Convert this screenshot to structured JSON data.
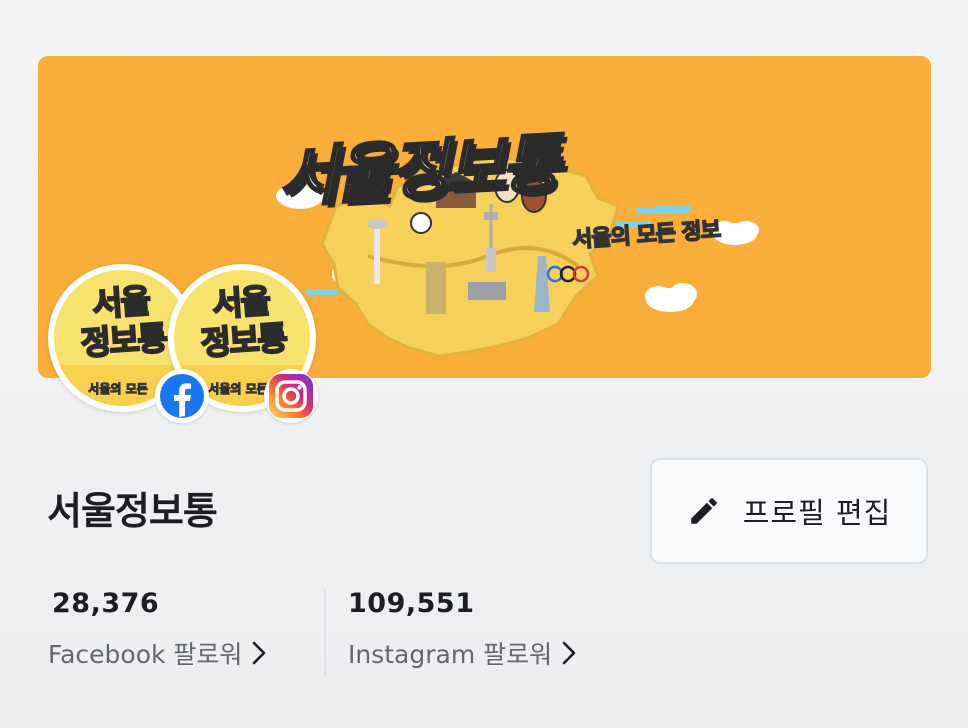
{
  "cover": {
    "title": "서울정보통",
    "subtitle": "서울의 모든 정보",
    "background_color": "#f9ae3a"
  },
  "avatars": [
    {
      "text": "서울\n정보통",
      "sub": "서울의 모든",
      "platform": "facebook",
      "badge_icon": "facebook-icon"
    },
    {
      "text": "서울\n정보통",
      "sub": "서울의 모든",
      "platform": "instagram",
      "badge_icon": "instagram-icon"
    }
  ],
  "profile": {
    "name": "서울정보통",
    "edit_button_label": "프로필 편집",
    "edit_icon": "pencil-icon"
  },
  "stats": [
    {
      "count": "28,376",
      "label": "Facebook 팔로워"
    },
    {
      "count": "109,551",
      "label": "Instagram 팔로워"
    }
  ],
  "colors": {
    "facebook_blue": "#1877f2",
    "text_primary": "#1c1e21",
    "text_secondary": "#65676b"
  }
}
